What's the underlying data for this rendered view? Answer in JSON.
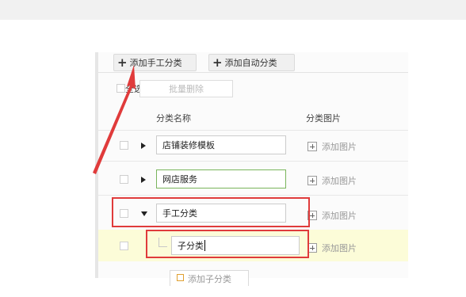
{
  "toolbar": {
    "add_manual_label": "添加手工分类",
    "add_auto_label": "添加自动分类",
    "select_all_label": "全选",
    "batch_delete_label": "批量删除"
  },
  "table": {
    "col_name": "分类名称",
    "col_image": "分类图片"
  },
  "rows": [
    {
      "name": "店铺装修模板",
      "image_action": "添加图片"
    },
    {
      "name": "网店服务",
      "image_action": "添加图片"
    },
    {
      "name": "手工分类",
      "image_action": "添加图片"
    },
    {
      "name": "子分类",
      "image_action": "添加图片"
    }
  ],
  "add_subcategory_label": "添加子分类",
  "colors": {
    "highlight_row": "#fcfcd8",
    "annotation_red": "#e03b3b",
    "active_input_border": "#7ab55c"
  }
}
